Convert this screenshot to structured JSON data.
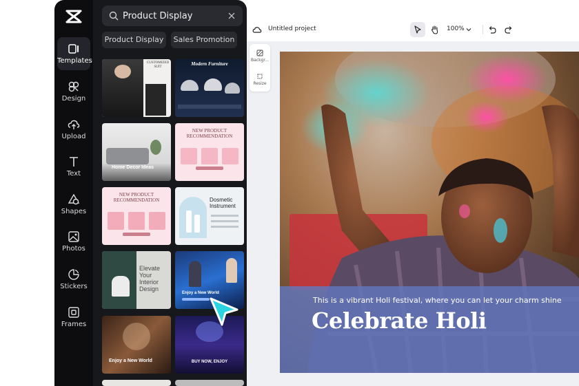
{
  "sidebar": {
    "items": [
      {
        "label": "Templates",
        "icon": "templates-icon",
        "active": true
      },
      {
        "label": "Design",
        "icon": "design-icon"
      },
      {
        "label": "Upload",
        "icon": "upload-icon"
      },
      {
        "label": "Text",
        "icon": "text-icon"
      },
      {
        "label": "Shapes",
        "icon": "shapes-icon"
      },
      {
        "label": "Photos",
        "icon": "photos-icon"
      },
      {
        "label": "Stickers",
        "icon": "stickers-icon"
      },
      {
        "label": "Frames",
        "icon": "frames-icon"
      }
    ]
  },
  "panel": {
    "search_value": "Product Display",
    "chips": [
      "Product Display",
      "Sales Promotion"
    ],
    "templates": [
      {
        "text": "CUSTOMIZED SUIT"
      },
      {
        "text": "Modern Furniture"
      },
      {
        "text": "Home Decor Ideas"
      },
      {
        "text": "NEW PRODUCT RECOMMENDATION"
      },
      {
        "text": "NEW PRODUCT RECOMMENDATION"
      },
      {
        "text": "Dosmetic Instrument"
      },
      {
        "text": "Elevate Your Interior Design"
      },
      {
        "text": "Enjoy a New World"
      },
      {
        "text": "Enjoy a New World"
      },
      {
        "text": "BUY NOW, ENJOY"
      }
    ]
  },
  "topbar": {
    "project_title": "Untitled project",
    "zoom": "100%"
  },
  "sidetool": {
    "background_label": "Backgr...",
    "resize_label": "Resize"
  },
  "canvas": {
    "subtitle": "This is a vibrant Holi festival, where you can let your charm shine",
    "title": "Celebrate Holi"
  },
  "colors": {
    "sidebar_bg": "#0d0d10",
    "panel_bg": "#17181c",
    "caption_band": "#6276be",
    "cursor": "#2ad4e0"
  }
}
